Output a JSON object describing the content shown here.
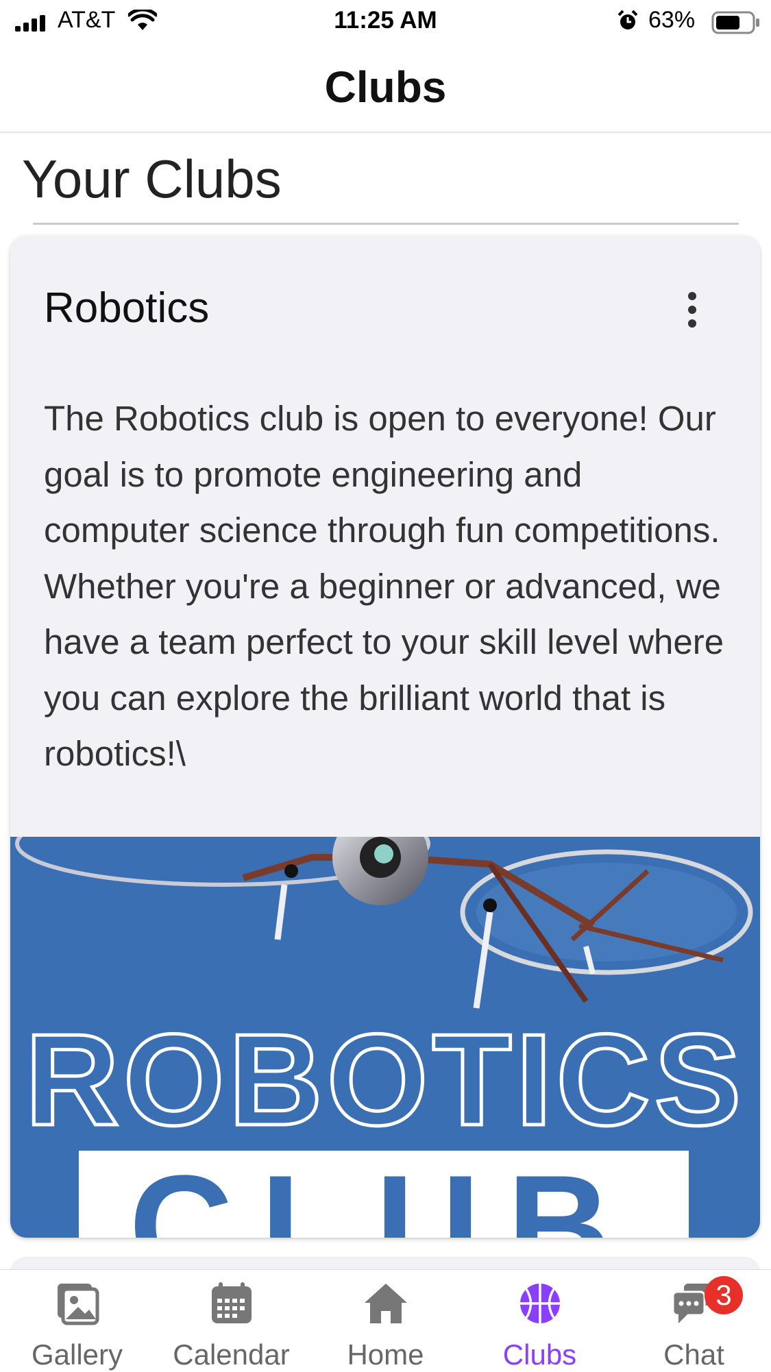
{
  "status_bar": {
    "carrier": "AT&T",
    "time": "11:25 AM",
    "battery_percent": "63%"
  },
  "header": {
    "title": "Clubs"
  },
  "section": {
    "title": "Your Clubs"
  },
  "club_card": {
    "name": "Robotics",
    "description": "The Robotics club is open to everyone! Our goal is to promote engineering and computer science through fun competitions. Whether you're a beginner or advanced, we have a team perfect to your skill level where you can explore the brilliant world that is robotics!\\",
    "banner": {
      "title": "ROBOTICS",
      "subtitle": "CLUB"
    }
  },
  "tab_bar": {
    "tabs": [
      {
        "label": "Gallery",
        "icon": "gallery-icon",
        "active": false
      },
      {
        "label": "Calendar",
        "icon": "calendar-icon",
        "active": false
      },
      {
        "label": "Home",
        "icon": "home-icon",
        "active": false
      },
      {
        "label": "Clubs",
        "icon": "basketball-icon",
        "active": true
      },
      {
        "label": "Chat",
        "icon": "chat-icon",
        "active": false
      }
    ],
    "chat_badge": "3"
  },
  "colors": {
    "accent": "#8a3ffc",
    "banner_blue": "#3a6fb3",
    "badge_red": "#e8302a"
  }
}
